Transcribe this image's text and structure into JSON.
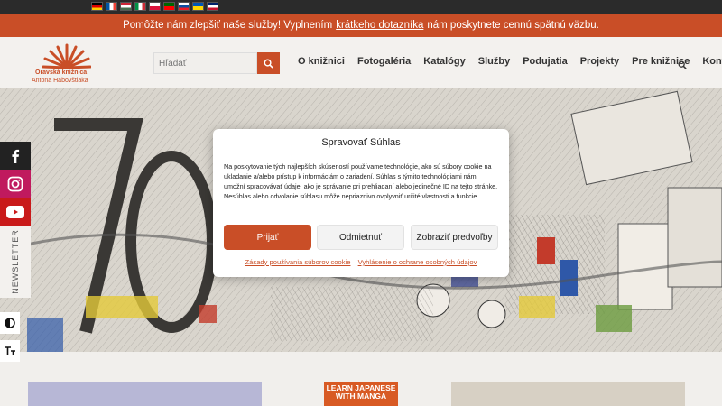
{
  "language_bar": {
    "flags": [
      {
        "name": "german-flag",
        "colors": [
          "#000000",
          "#dd0000",
          "#ffce00"
        ]
      },
      {
        "name": "french-flag",
        "colors": [
          "#0055a4",
          "#ffffff",
          "#ef4135"
        ]
      },
      {
        "name": "hungarian-flag",
        "colors": [
          "#ce2939",
          "#ffffff",
          "#477050"
        ]
      },
      {
        "name": "italian-flag",
        "colors": [
          "#009246",
          "#ffffff",
          "#ce2b37"
        ]
      },
      {
        "name": "polish-flag",
        "colors": [
          "#ffffff",
          "#dc143c"
        ]
      },
      {
        "name": "portuguese-flag",
        "colors": [
          "#006600",
          "#ff0000"
        ]
      },
      {
        "name": "slovak-flag",
        "colors": [
          "#ffffff",
          "#0b4ea2",
          "#ee1c25"
        ]
      },
      {
        "name": "ukrainian-flag",
        "colors": [
          "#0057b7",
          "#ffd700"
        ]
      },
      {
        "name": "english-flag",
        "colors": [
          "#012169",
          "#ffffff",
          "#c8102e"
        ]
      }
    ]
  },
  "notice": {
    "text_before": "Pomôžte nám zlepšiť naše služby! Vyplnením",
    "link": "krátkeho dotazníka",
    "text_after": "nám poskytnete cennú spätnú väzbu."
  },
  "logo": {
    "line1": "Oravská knižnica",
    "line2": "Antona Habovštiaka"
  },
  "search": {
    "placeholder": "Hľadať"
  },
  "nav": {
    "items": [
      "O knižnici",
      "Fotogaléria",
      "Katalógy",
      "Služby",
      "Podujatia",
      "Projekty",
      "Pre knižnice",
      "Kontakty"
    ]
  },
  "social": {
    "newsletter": "NEWSLETTER"
  },
  "consent": {
    "title": "Spravovať Súhlas",
    "body": "Na poskytovanie tých najlepších skúseností používame technológie, ako sú súbory cookie na ukladanie a/alebo prístup k informáciám o zariadení. Súhlas s týmito technológiami nám umožní spracovávať údaje, ako je správanie pri prehliadaní alebo jedinečné ID na tejto stránke. Nesúhlas alebo odvolanie súhlasu môže nepriaznivo ovplyvniť určité vlastnosti a funkcie.",
    "accept": "Prijať",
    "deny": "Odmietnuť",
    "preferences": "Zobraziť predvoľby",
    "cookie_policy": "Zásady používania súborov cookie",
    "privacy": "Vyhlásenie o ochrane osobných údajov"
  },
  "cards": {
    "book_title_line1": "LEARN JAPANESE",
    "book_title_line2": "WITH MANGA"
  },
  "colors": {
    "accent": "#c94e27",
    "dark": "#2b2b2b"
  }
}
